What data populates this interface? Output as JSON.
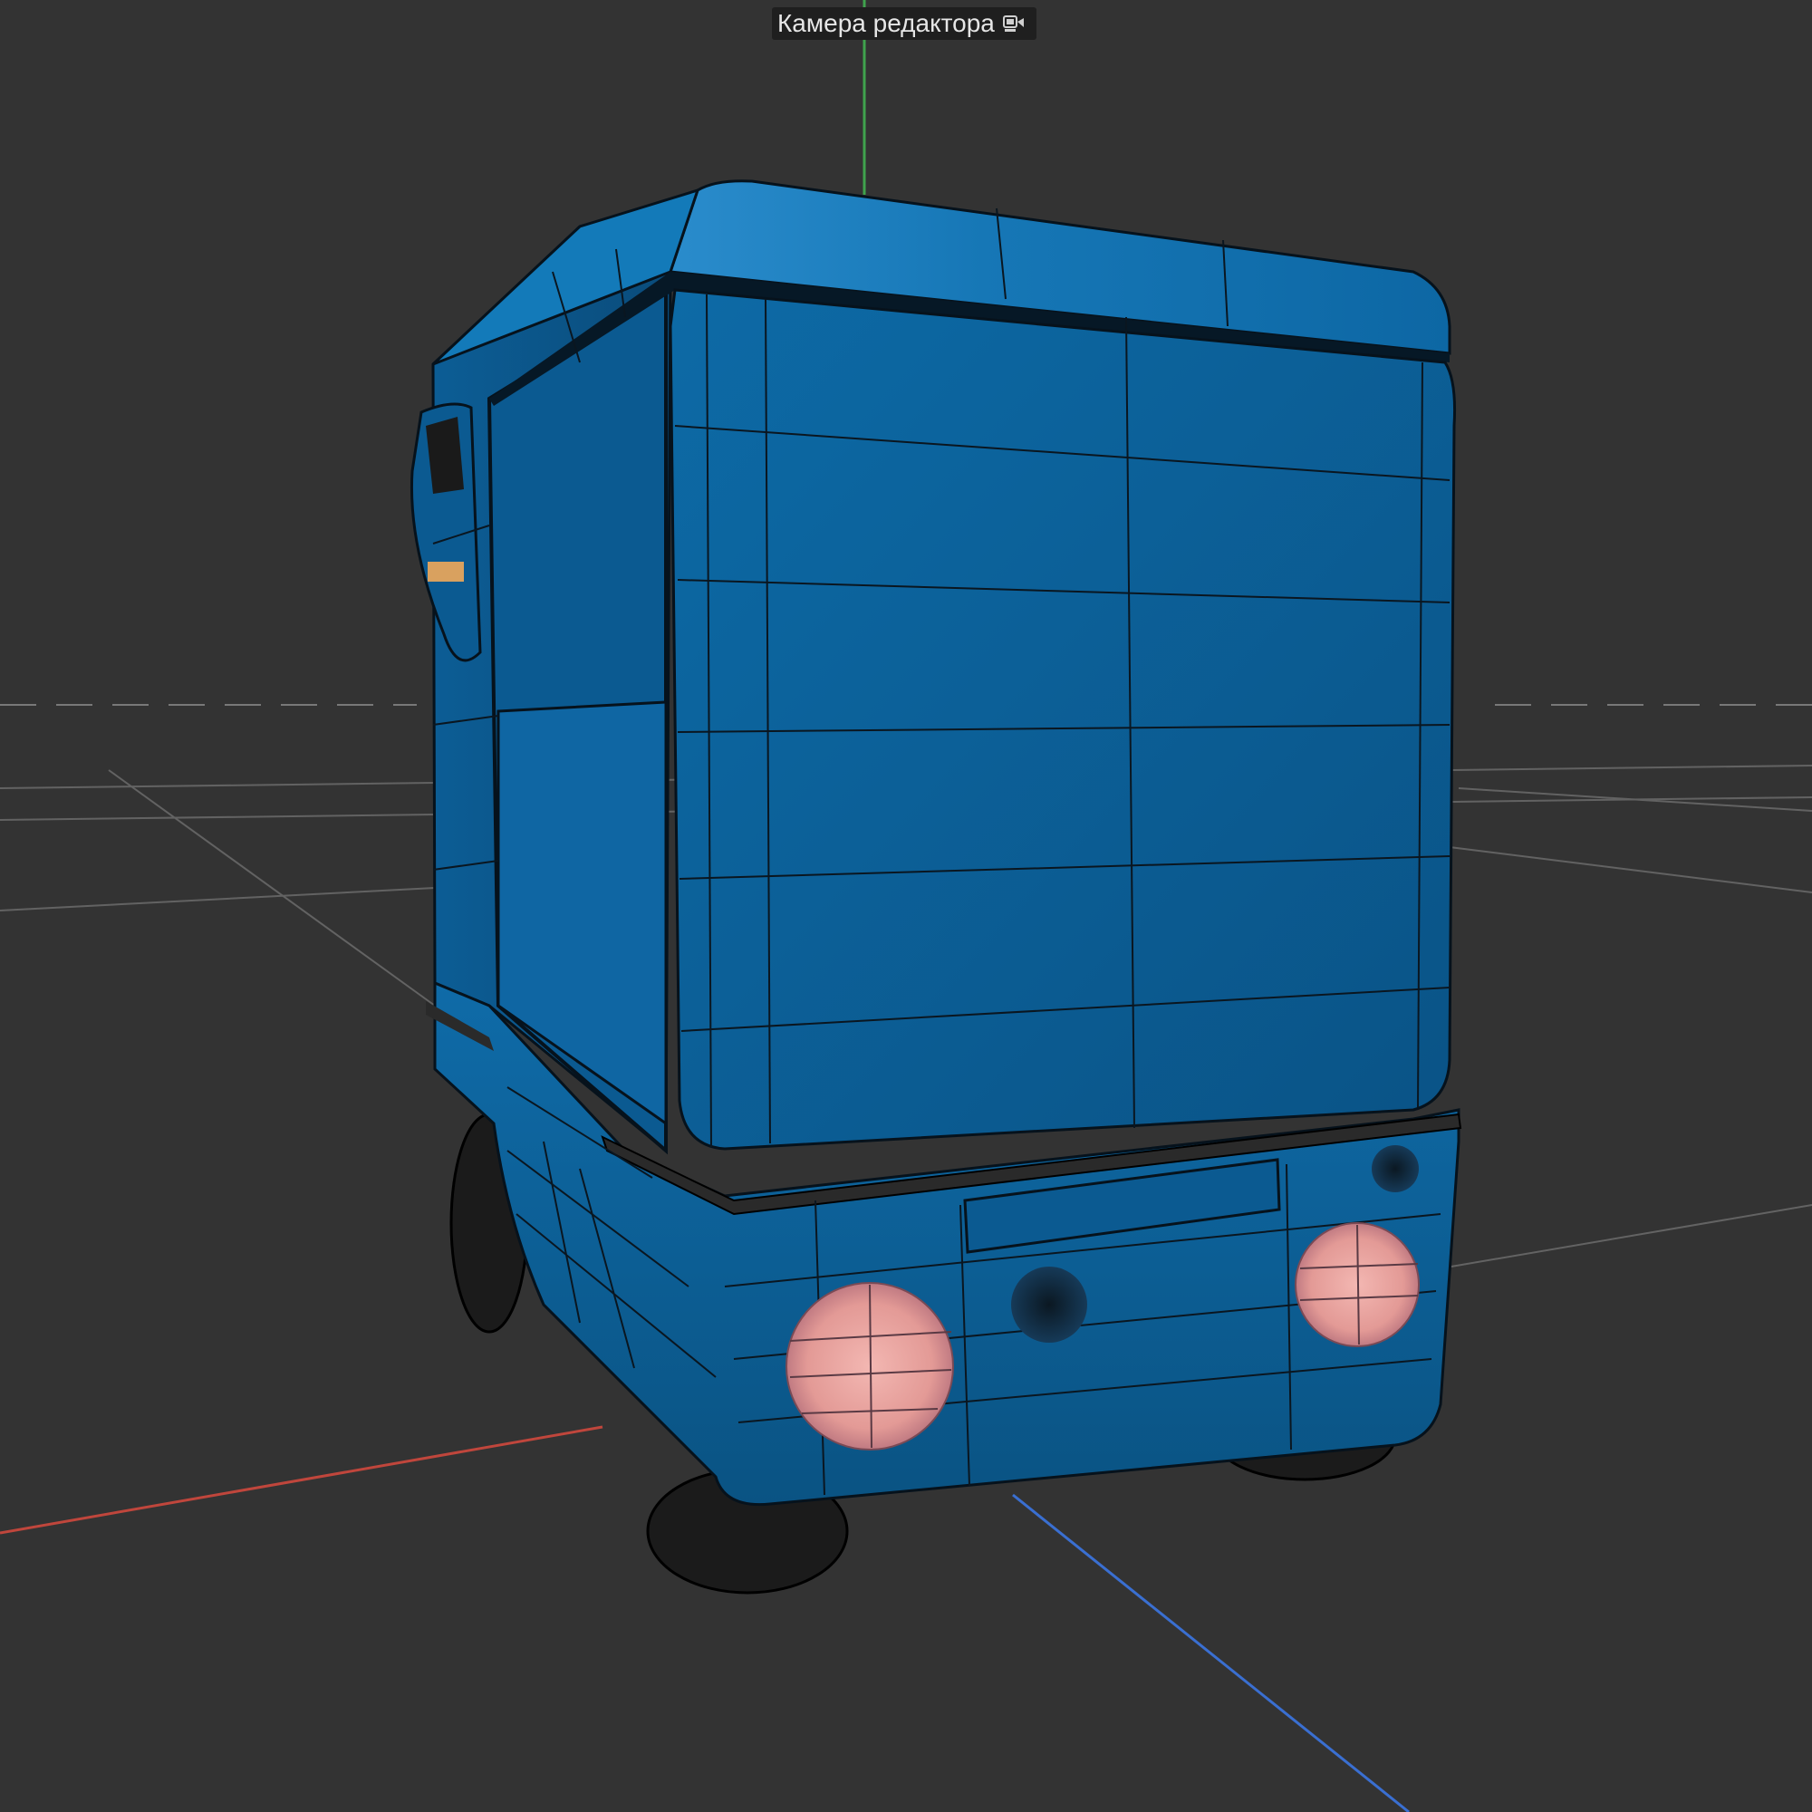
{
  "viewport": {
    "camera_label": "Камера редактора",
    "camera_icon": "camera-icon",
    "background_color": "#333333",
    "axis_colors": {
      "x": "#c0463c",
      "y": "#3fa34d",
      "z": "#3a6fd1"
    },
    "model": {
      "body_color": "#0d5f97",
      "taillight_color": "#e8a3a0",
      "wire_color": "#0a1620"
    }
  }
}
